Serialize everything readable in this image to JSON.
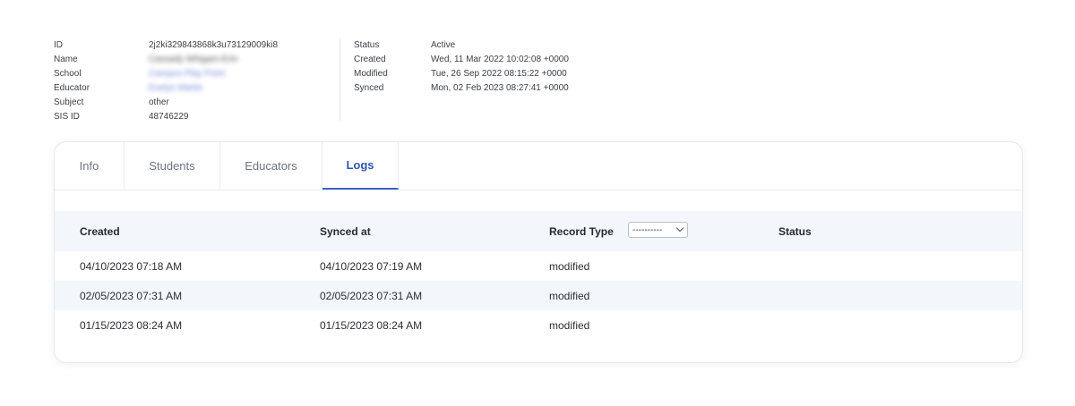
{
  "meta_left": [
    {
      "key": "ID",
      "value": "2j2ki329843868k3u73129009ki8"
    },
    {
      "key": "Name",
      "value": "Cassady Whigam-Erin"
    },
    {
      "key": "School",
      "value": "Campus Play Point"
    },
    {
      "key": "Educator",
      "value": "Evelyn Martin"
    },
    {
      "key": "Subject",
      "value": "other"
    },
    {
      "key": "SIS ID",
      "value": "48746229"
    }
  ],
  "meta_right": [
    {
      "key": "Status",
      "value": "Active"
    },
    {
      "key": "Created",
      "value": "Wed, 11 Mar 2022 10:02:08 +0000"
    },
    {
      "key": "Modified",
      "value": "Tue, 26 Sep 2022 08:15:22 +0000"
    },
    {
      "key": "Synced",
      "value": "Mon, 02 Feb 2023 08:27:41 +0000"
    }
  ],
  "tabs": [
    {
      "label": "Info"
    },
    {
      "label": "Students"
    },
    {
      "label": "Educators"
    },
    {
      "label": "Logs",
      "active": true
    }
  ],
  "table": {
    "headers": {
      "created": "Created",
      "synced": "Synced at",
      "record_type": "Record Type",
      "status": "Status"
    },
    "record_type_filter": "----------",
    "rows": [
      {
        "created": "04/10/2023 07:18 AM",
        "synced": "04/10/2023 07:19 AM",
        "record_type": "modified",
        "status": ""
      },
      {
        "created": "02/05/2023 07:31 AM",
        "synced": "02/05/2023 07:31 AM",
        "record_type": "modified",
        "status": ""
      },
      {
        "created": "01/15/2023 08:24 AM",
        "synced": "01/15/2023 08:24 AM",
        "record_type": "modified",
        "status": ""
      }
    ]
  },
  "colors": {
    "accent": "#3b63c4",
    "row_alt": "#f3f7fb"
  }
}
